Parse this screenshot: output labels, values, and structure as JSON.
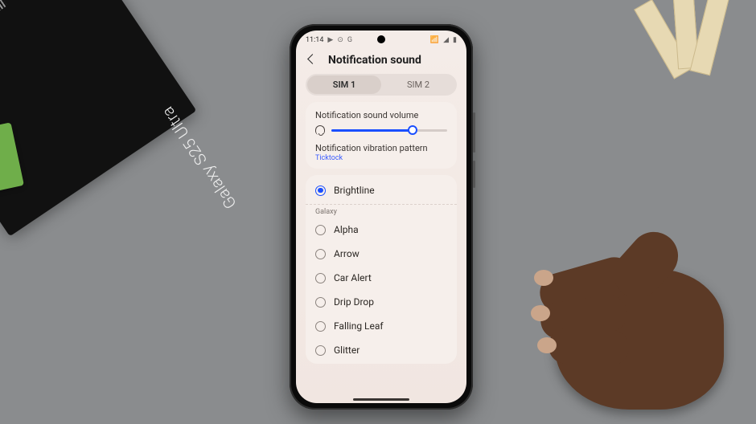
{
  "context": {
    "box_label": "Galaxy S25 Ultra"
  },
  "status": {
    "time": "11:14",
    "left_icons": [
      "▶",
      "⊙",
      "G"
    ],
    "right_icons": [
      "📶",
      "◢",
      "▮"
    ]
  },
  "header": {
    "title": "Notification sound"
  },
  "tabs": [
    {
      "label": "SIM 1",
      "active": true
    },
    {
      "label": "SIM 2",
      "active": false
    }
  ],
  "volume": {
    "label": "Notification sound volume",
    "percent": 70
  },
  "vibration": {
    "label": "Notification vibration pattern",
    "value": "Ticktock"
  },
  "sounds": {
    "selected": "Brightline",
    "group_label": "Galaxy",
    "items": [
      "Alpha",
      "Arrow",
      "Car Alert",
      "Drip Drop",
      "Falling Leaf",
      "Glitter"
    ]
  }
}
